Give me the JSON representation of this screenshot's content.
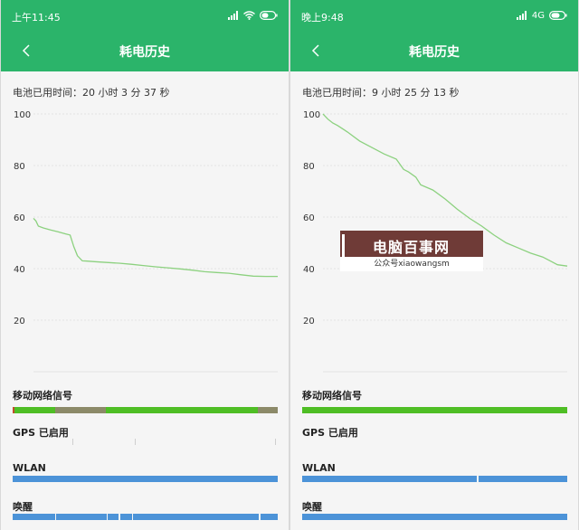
{
  "screens": [
    {
      "status": {
        "time": "上午11:45",
        "network_label": ""
      },
      "header": {
        "title": "耗电历史"
      },
      "duration": "电池已用时间：20 小时 3 分 37 秒",
      "chart_data": {
        "type": "line",
        "y_ticks": [
          "100",
          "80",
          "60",
          "40",
          "20"
        ],
        "ylim": [
          0,
          100
        ],
        "xlim": [
          0,
          1
        ],
        "grid": true,
        "color": "#8cd17f",
        "series": [
          {
            "x": [
              0.0,
              0.01,
              0.02,
              0.04,
              0.07,
              0.1,
              0.13,
              0.15,
              0.165,
              0.18,
              0.2,
              0.22,
              0.25,
              0.3,
              0.35,
              0.4,
              0.45,
              0.5,
              0.55,
              0.6,
              0.65,
              0.7,
              0.75,
              0.8,
              0.85,
              0.9,
              0.95,
              1.0
            ],
            "y": [
              59.5,
              58.5,
              56.5,
              55.8,
              55.0,
              54.3,
              53.5,
              53.0,
              48.5,
              45.0,
              43.0,
              42.9,
              42.7,
              42.4,
              42.1,
              41.7,
              41.2,
              40.7,
              40.3,
              39.9,
              39.4,
              38.8,
              38.5,
              38.2,
              37.6,
              37.1,
              37.0,
              37.0
            ]
          }
        ]
      },
      "sections": [
        "移动网络信号",
        "GPS 已启用",
        "WLAN",
        "唤醒"
      ],
      "signal_bar": [
        {
          "from": 0.0,
          "to": 0.008,
          "color": "#c24d2c"
        },
        {
          "from": 0.008,
          "to": 0.16,
          "color": "#4fbe25"
        },
        {
          "from": 0.16,
          "to": 0.35,
          "color": "#8c8a69"
        },
        {
          "from": 0.35,
          "to": 0.925,
          "color": "#4fbe25"
        },
        {
          "from": 0.925,
          "to": 1.0,
          "color": "#8c8a69"
        }
      ],
      "gps_ticks": [
        0.225,
        0.46,
        0.99
      ],
      "wlan_bar": [
        {
          "from": 0.0,
          "to": 1.0,
          "color": "#4c93d8"
        }
      ],
      "wake_bar": [
        {
          "from": 0.0,
          "to": 0.16,
          "color": "#4c93d8"
        },
        {
          "from": 0.165,
          "to": 0.355,
          "color": "#4c93d8"
        },
        {
          "from": 0.36,
          "to": 0.4,
          "color": "#4c93d8"
        },
        {
          "from": 0.405,
          "to": 0.45,
          "color": "#4c93d8"
        },
        {
          "from": 0.455,
          "to": 0.93,
          "color": "#4c93d8"
        },
        {
          "from": 0.935,
          "to": 1.0,
          "color": "#4c93d8"
        }
      ]
    },
    {
      "status": {
        "time": "晚上9:48",
        "network_label": "4G"
      },
      "header": {
        "title": "耗电历史"
      },
      "duration": "电池已用时间：9 小时 25 分 13 秒",
      "chart_data": {
        "type": "line",
        "y_ticks": [
          "100",
          "80",
          "60",
          "40",
          "20"
        ],
        "ylim": [
          0,
          100
        ],
        "xlim": [
          0,
          1
        ],
        "grid": true,
        "color": "#8cd17f",
        "series": [
          {
            "x": [
              0.0,
              0.02,
              0.04,
              0.06,
              0.1,
              0.15,
              0.2,
              0.25,
              0.3,
              0.33,
              0.35,
              0.38,
              0.4,
              0.45,
              0.5,
              0.55,
              0.6,
              0.65,
              0.7,
              0.75,
              0.8,
              0.85,
              0.9,
              0.93,
              0.96,
              1.0
            ],
            "y": [
              100.0,
              98.0,
              96.5,
              95.5,
              93.0,
              89.5,
              87.0,
              84.5,
              82.5,
              78.5,
              77.5,
              75.5,
              72.5,
              70.5,
              67.0,
              63.0,
              59.5,
              56.5,
              53.0,
              50.0,
              48.0,
              46.0,
              44.5,
              43.0,
              41.5,
              41.0
            ]
          }
        ]
      },
      "sections": [
        "移动网络信号",
        "GPS 已启用",
        "WLAN",
        "唤醒"
      ],
      "signal_bar": [
        {
          "from": 0.0,
          "to": 1.0,
          "color": "#4fbe25"
        }
      ],
      "gps_ticks": [],
      "wlan_bar": [
        {
          "from": 0.0,
          "to": 0.66,
          "color": "#4c93d8"
        },
        {
          "from": 0.664,
          "to": 1.0,
          "color": "#4c93d8"
        }
      ],
      "wake_bar": [
        {
          "from": 0.0,
          "to": 1.0,
          "color": "#4c93d8"
        }
      ]
    }
  ],
  "watermark": {
    "title": "电脑百事网",
    "subtitle": "公众号xiaowangsm"
  },
  "colors": {
    "header_green": "#2bb46a",
    "line_green": "#8cd17f",
    "signal_green": "#4fbe25",
    "wlan_blue": "#4c93d8"
  }
}
